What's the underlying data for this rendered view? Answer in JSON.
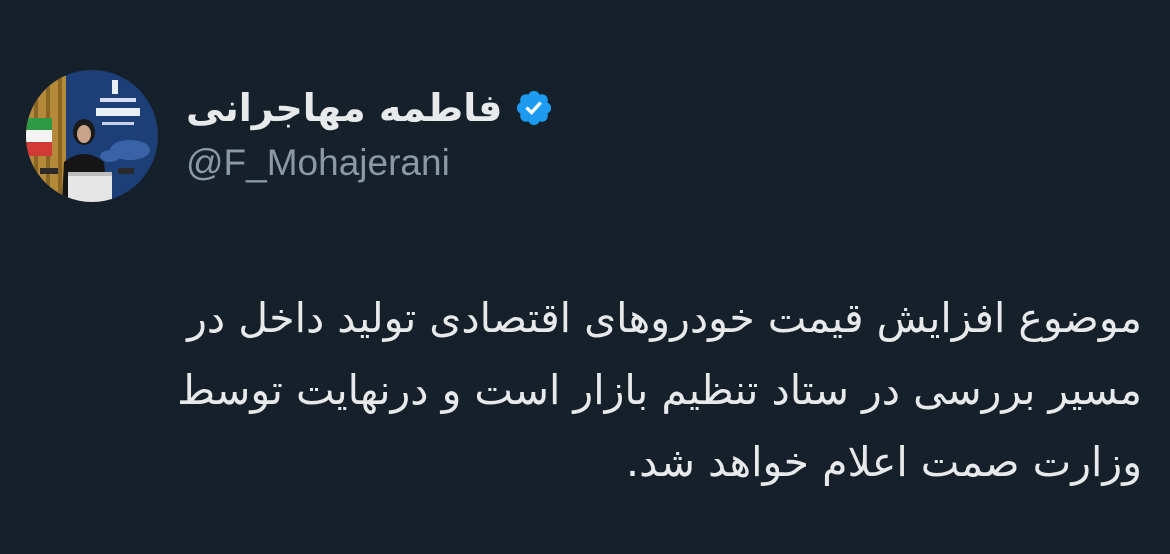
{
  "tweet": {
    "author": {
      "display_name": "فاطمه مهاجرانی",
      "handle": "@F_Mohajerani",
      "verified": true,
      "verified_icon": "verified-badge-icon",
      "avatar": "avatar-photo"
    },
    "text_lines": [
      "موضوع افزایش قیمت خودروهای اقتصادی تولید داخل در",
      "مسیر بررسی در ستاد تنظیم بازار است و درنهایت توسط",
      "وزارت صمت اعلام خواهد شد."
    ]
  },
  "colors": {
    "background": "#15202b",
    "text": "#e7e9ea",
    "handle": "#8b98a5",
    "verified": "#1d9bf0"
  }
}
